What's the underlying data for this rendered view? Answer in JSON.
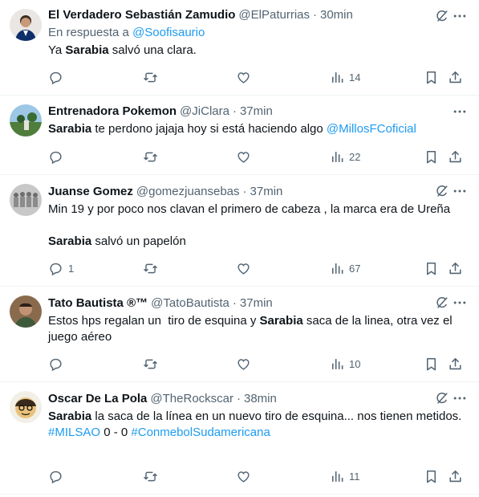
{
  "tweets": [
    {
      "name": "El Verdadero Sebastián Zamudio",
      "handle": "@ElPaturrias",
      "dot": "·",
      "time": "30min",
      "reply_prefix": "En respuesta a ",
      "reply_to": "@Soofisaurio",
      "body": {
        "p1_bold": "",
        "p1_text": "Ya ",
        "p1_bold2": "Sarabia",
        "p1_text2": " salvó una clara."
      },
      "replies": "",
      "views": "14"
    },
    {
      "name": "Entrenadora Pokemon",
      "handle": "@JiClara",
      "dot": "·",
      "time": "37min",
      "body": {
        "bold": "Sarabia",
        "text": " te perdono jajaja hoy si está haciendo algo ",
        "mention": "@MillosFCoficial"
      },
      "replies": "",
      "views": "22"
    },
    {
      "name": "Juanse Gomez",
      "handle": "@gomezjuansebas",
      "dot": "·",
      "time": "37min",
      "body": {
        "line1": "Min 19 y por poco nos clavan el primero de cabeza , la marca era de Ureña",
        "bold": "Sarabia",
        "text": " salvó un papelón"
      },
      "replies": "1",
      "views": "67"
    },
    {
      "name": "Tato Bautista ®™",
      "handle": "@TatoBautista",
      "dot": "·",
      "time": "37min",
      "body": {
        "text1": "Estos hps regalan un  tiro de esquina y ",
        "bold": "Sarabia",
        "text2": " saca de la linea, otra vez el juego aéreo"
      },
      "replies": "",
      "views": "10"
    },
    {
      "name": "Oscar De La Pola",
      "handle": "@TheRockscar",
      "dot": "·",
      "time": "38min",
      "body": {
        "bold": "Sarabia",
        "text": " la saca de la línea en un nuevo tiro de esquina... nos tienen metidos.",
        "tag1": "#MILSAO",
        "score": " 0 - 0 ",
        "tag2": "#ConmebolSudamericana"
      },
      "replies": "",
      "views": "11"
    }
  ],
  "icons": {
    "reply": "reply-icon",
    "retweet": "retweet-icon",
    "like": "heart-icon",
    "views": "views-icon",
    "bookmark": "bookmark-icon",
    "share": "share-icon",
    "grok": "grok-icon",
    "more": "more-icon"
  },
  "colors": {
    "link": "#1d9bf0",
    "muted": "#536471",
    "text": "#0f1419",
    "divider": "#eff3f4"
  }
}
